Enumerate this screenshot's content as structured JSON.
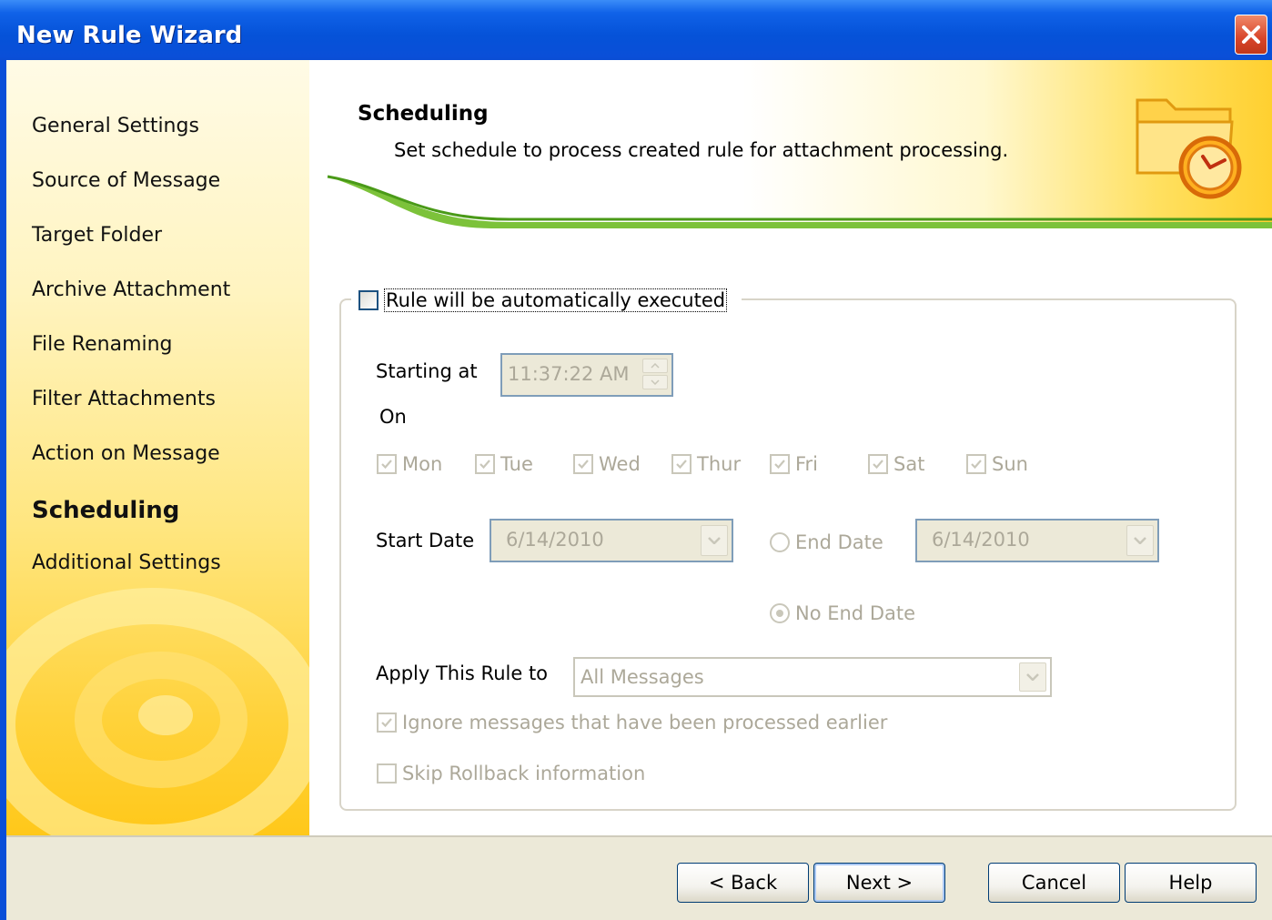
{
  "window": {
    "title": "New Rule Wizard"
  },
  "sidebar": {
    "items": [
      {
        "label": "General Settings",
        "active": false
      },
      {
        "label": "Source of Message",
        "active": false
      },
      {
        "label": "Target Folder",
        "active": false
      },
      {
        "label": "Archive Attachment",
        "active": false
      },
      {
        "label": "File Renaming",
        "active": false
      },
      {
        "label": "Filter Attachments",
        "active": false
      },
      {
        "label": "Action on Message",
        "active": false
      },
      {
        "label": "Scheduling",
        "active": true
      },
      {
        "label": "Additional Settings",
        "active": false
      }
    ]
  },
  "header": {
    "title": "Scheduling",
    "subtitle": "Set schedule to process created rule for attachment processing.",
    "icon": "folder-clock-icon"
  },
  "schedule": {
    "auto_execute": {
      "label": "Rule will be automatically executed",
      "checked": false
    },
    "starting_at_label": "Starting at",
    "time_value": "11:37:22 AM",
    "on_label": "On",
    "days": [
      {
        "label": "Mon",
        "checked": true
      },
      {
        "label": "Tue",
        "checked": true
      },
      {
        "label": "Wed",
        "checked": true
      },
      {
        "label": "Thur",
        "checked": true
      },
      {
        "label": "Fri",
        "checked": true
      },
      {
        "label": "Sat",
        "checked": true
      },
      {
        "label": "Sun",
        "checked": true
      }
    ],
    "start_date_label": "Start Date",
    "start_date_value": "6/14/2010",
    "end_date_option": "End Date",
    "end_date_value": "6/14/2010",
    "no_end_date_option": "No End Date",
    "selected_end_option": "No End Date",
    "apply_label": "Apply This Rule to",
    "apply_value": "All Messages",
    "ignore_processed": {
      "label": "Ignore messages that have been processed earlier",
      "checked": true
    },
    "skip_rollback": {
      "label": "Skip Rollback information",
      "checked": false
    }
  },
  "footer": {
    "back": "< Back",
    "next": "Next >",
    "cancel": "Cancel",
    "help": "Help"
  },
  "colors": {
    "titlebar": "#0a4fd8",
    "accent_green": "#5aa81e",
    "sidebar_yellow": "#ffd23a",
    "disabled_text": "#aca899"
  }
}
